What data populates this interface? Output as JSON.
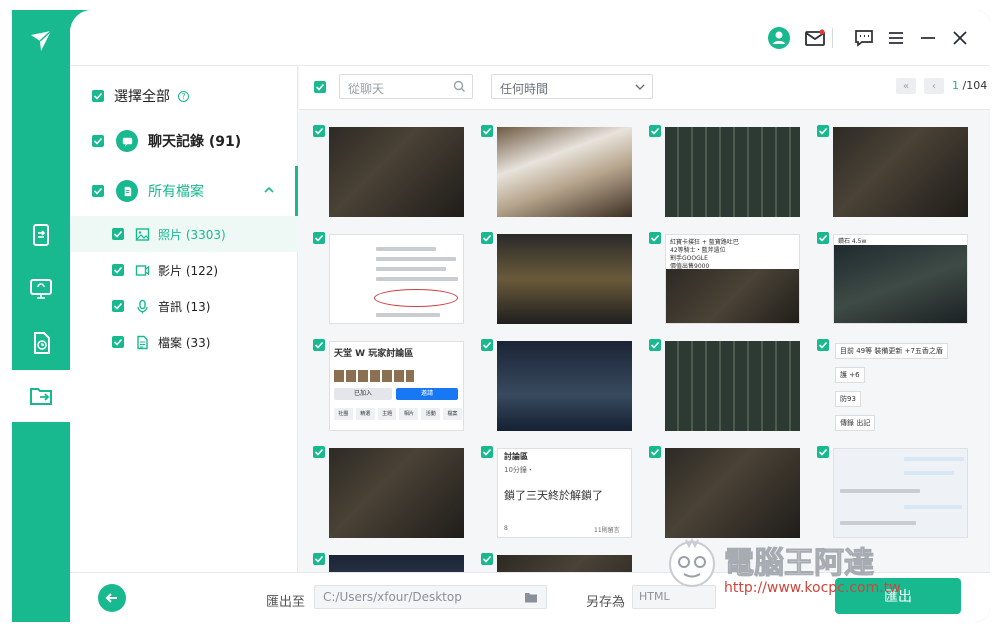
{
  "sidebar": {
    "select_all": "選擇全部",
    "chat_records": "聊天記錄 (91)",
    "all_files": "所有檔案",
    "items": [
      {
        "label": "照片 (3303)",
        "icon": "image-icon",
        "selected": true
      },
      {
        "label": "影片 (122)",
        "icon": "video-icon",
        "selected": false
      },
      {
        "label": "音訊 (13)",
        "icon": "microphone-icon",
        "selected": false
      },
      {
        "label": "檔案 (33)",
        "icon": "document-icon",
        "selected": false
      }
    ]
  },
  "toolbar": {
    "search_placeholder": "從聊天",
    "time_filter": "任何時間",
    "page_current": "1",
    "page_total": "/104",
    "first_label": "«",
    "prev_label": "‹",
    "next_label": "›",
    "last_label": "»"
  },
  "thumbs": {
    "fb_group": "天堂 W 玩家討論區",
    "fb_join": "已加入",
    "fb_invite": "邀請",
    "fb_tabs": [
      "社團",
      "精選",
      "主題",
      "相片",
      "活動",
      "檔案"
    ],
    "chat_lines": [
      "目前 49等 裝備更新 +7五香之盾",
      "護 +6",
      "防93",
      "傳錄 出記"
    ],
    "post_title": "討論區",
    "post_meta": "10分鐘・",
    "post_body": "鎖了三天終於解鎖了",
    "post_count": "8",
    "post_comments": "11則留言",
    "doc_caption_line": "紅寶卡撲狂 + 藍寶路吐巴",
    "doc_caption_line2": "42等騎士・藍斧遺位",
    "doc_caption_line3": "割手GOOGLE",
    "doc_caption_line4": "價值出售9000",
    "small_caption": "鑽石 4.5w"
  },
  "footer": {
    "export_to_label": "匯出至",
    "export_path": "C:/Users/xfour/Desktop",
    "save_as_label": "另存為",
    "format_value": "HTML",
    "export_button": "匯出"
  },
  "watermark": {
    "title": "電腦王阿達",
    "url": "http://www.kocpc.com.tw"
  },
  "colors": {
    "accent": "#18b98f"
  }
}
